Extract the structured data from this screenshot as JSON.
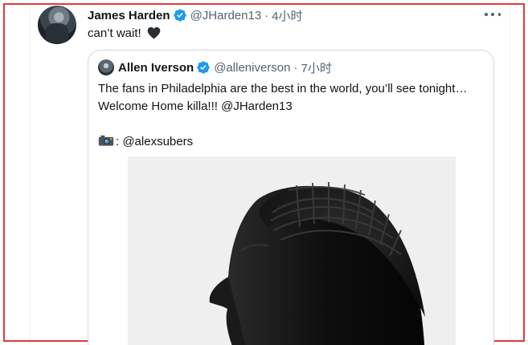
{
  "tweet": {
    "author_name": "James Harden",
    "handle": "@JHarden13",
    "separator": "·",
    "time": "4小时",
    "text": "can’t wait!",
    "more_icon": "more-dots-icon",
    "verified_icon": "verified-badge-icon",
    "heart_icon": "black-heart-emoji"
  },
  "quoted_tweet": {
    "author_name": "Allen Iverson",
    "handle": "@alleniverson",
    "separator": "·",
    "time": "7小时",
    "line1": "The fans in Philadelphia are the best in the world, you’ll see tonight…",
    "line2": "Welcome Home killa!!! @JHarden13",
    "credit": ": @alexsubers",
    "camera_icon": "camera-emoji",
    "photo": "black-and-white-portrait-photo"
  },
  "colors": {
    "verified_blue": "#1d9bf0",
    "secondary_text": "#536471",
    "border": "#cfd9de",
    "highlight_frame": "#e23a3a"
  }
}
